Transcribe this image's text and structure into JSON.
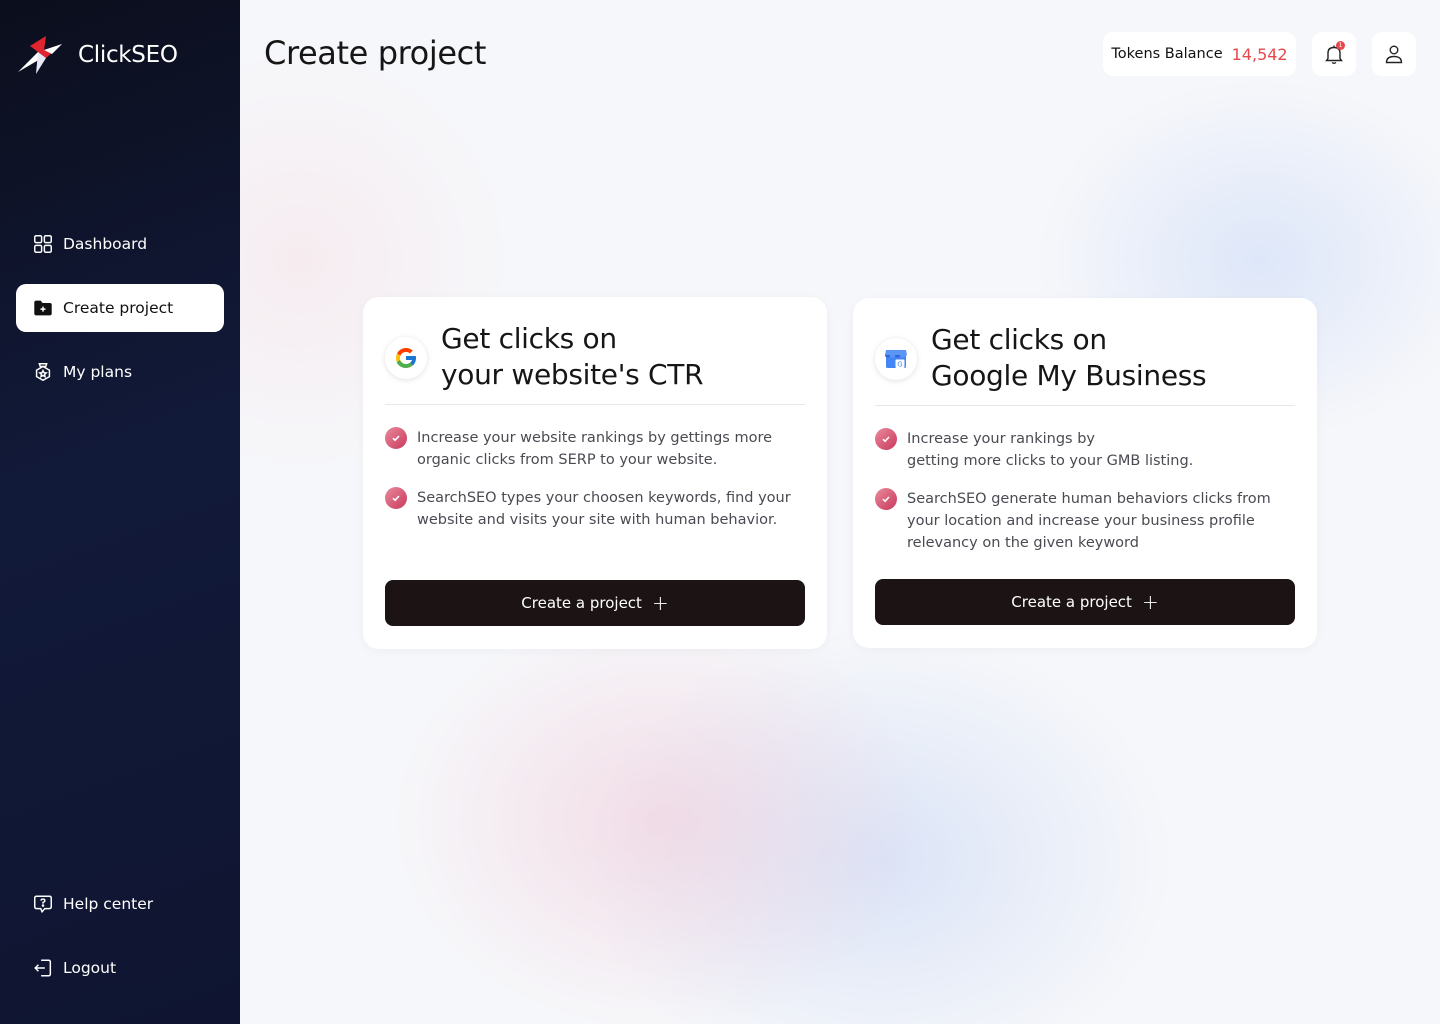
{
  "app": {
    "name": "ClickSEO"
  },
  "sidebar": {
    "items": [
      {
        "label": "Dashboard",
        "icon": "grid-icon"
      },
      {
        "label": "Create project",
        "icon": "folder-plus-icon",
        "active": true
      },
      {
        "label": "My plans",
        "icon": "badge-icon"
      }
    ],
    "bottom": [
      {
        "label": "Help center",
        "icon": "help-icon"
      },
      {
        "label": "Logout",
        "icon": "logout-icon"
      }
    ]
  },
  "header": {
    "title": "Create project",
    "tokens_label": "Tokens Balance",
    "tokens_value": "14,542",
    "notification_count": "1"
  },
  "cards": [
    {
      "title_line1": "Get clicks on",
      "title_line2": "your website's CTR",
      "logo": "google-logo",
      "features": [
        {
          "line1": "Increase your website rankings by gettings  more",
          "line2": "organic clicks from SERP to your website."
        },
        {
          "line1": "SearchSEO types your choosen keywords, find your",
          "line2": "website and visits your site with human behavior."
        }
      ],
      "cta": "Create a project"
    },
    {
      "title_line1": "Get clicks on",
      "title_line2": "Google My Business",
      "logo": "google-my-business-logo",
      "features": [
        {
          "line1": "Increase your rankings by",
          "line2": "getting more clicks to your GMB listing."
        },
        {
          "line1": "SearchSEO generate human behaviors clicks from",
          "line2": "your location and increase your business profile",
          "line3": "relevancy on the given keyword"
        }
      ],
      "cta": "Create a project"
    }
  ],
  "colors": {
    "accent": "#e5484d",
    "sidebar": "#0f1530",
    "button": "#1c1414",
    "check": "#d0496a"
  }
}
